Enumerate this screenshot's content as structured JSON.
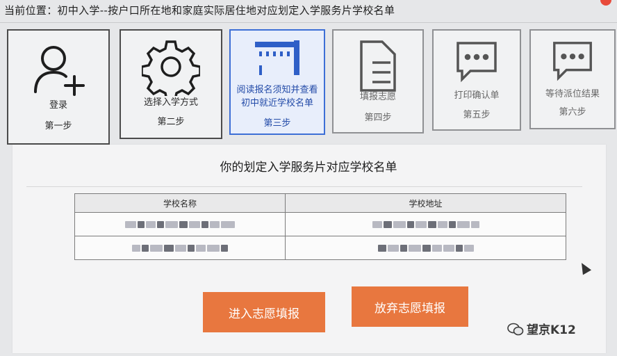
{
  "breadcrumb": {
    "label": "当前位置：",
    "path": "初中入学--按户口所在地和家庭实际居住地对应划定入学服务片学校名单"
  },
  "steps": [
    {
      "label": "登录",
      "step": "第一步",
      "icon": "user-add-icon"
    },
    {
      "label": "选择入学方式",
      "step": "第二步",
      "icon": "gear-icon"
    },
    {
      "label": "阅读报名须知并查看初中就近学校名单",
      "step": "第三步",
      "icon": "building-icon"
    },
    {
      "label": "填报志愿",
      "step": "第四步",
      "icon": "document-icon"
    },
    {
      "label": "打印确认单",
      "step": "第五步",
      "icon": "chat-bubble-icon"
    },
    {
      "label": "等待派位结果",
      "step": "第六步",
      "icon": "chat-bubble-icon"
    }
  ],
  "panel": {
    "title": "你的划定入学服务片对应学校名单"
  },
  "table": {
    "headers": [
      "学校名称",
      "学校地址"
    ]
  },
  "buttons": {
    "enter": "进入志愿填报",
    "abandon": "放弃志愿填报"
  },
  "watermark": "望京K12",
  "colors": {
    "accent_button": "#e8773f",
    "active_step": "#3d6fd6"
  }
}
